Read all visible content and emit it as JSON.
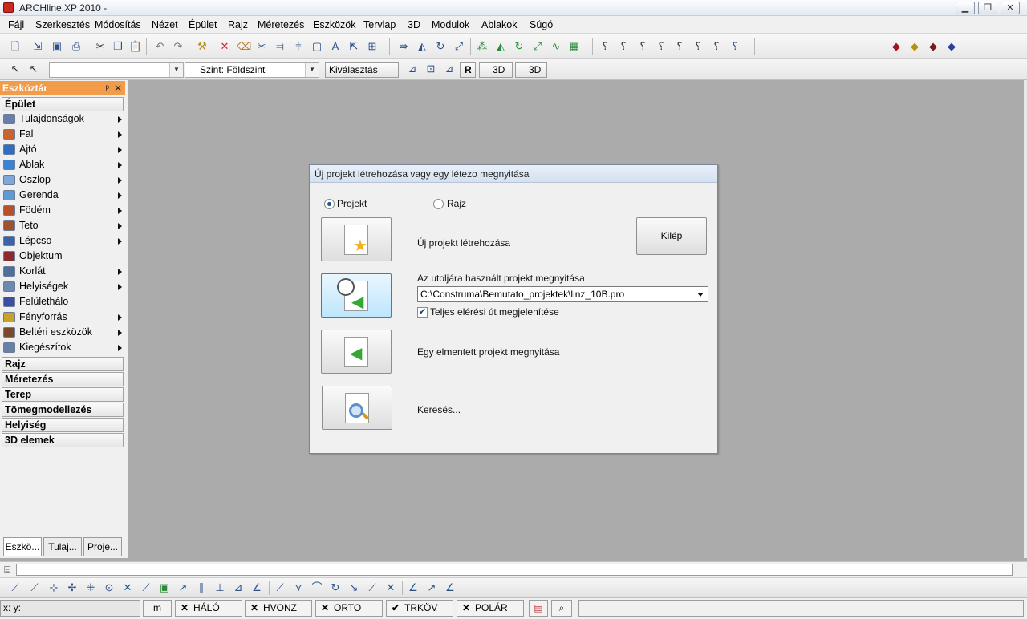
{
  "window": {
    "title": "ARCHline.XP 2010 -",
    "btn_min": "▁",
    "btn_restore": "❐",
    "btn_close": "✕"
  },
  "menu": [
    "Fájl",
    "Szerkesztés",
    "Módosítás",
    "Nézet",
    "Épület",
    "Rajz",
    "Méretezés",
    "Eszközök",
    "Tervlap",
    "3D",
    "Modulok",
    "Ablakok",
    "Súgó"
  ],
  "toolbar2": {
    "level_combo": "Szint:  Földszint",
    "select_button": "Kiválasztás",
    "btn_r": "R",
    "btn_3d_a": "3D",
    "btn_3d_b": "3D"
  },
  "panel": {
    "title": "Eszköztár",
    "pin": "ᵖ",
    "close": "✕",
    "section_epulet": "Épület",
    "items": [
      "Tulajdonságok",
      "Fal",
      "Ajtó",
      "Ablak",
      "Oszlop",
      "Gerenda",
      "Födém",
      "Teto",
      "Lépcso",
      "Objektum",
      "Korlát",
      "Helyiségek",
      "Felülethálo",
      "Fényforrás",
      "Beltéri eszközök",
      "Kiegészítok"
    ],
    "item_colors": [
      "#6a7fa6",
      "#c8642e",
      "#2d6fc2",
      "#3b82d0",
      "#7fa8d8",
      "#5e9ad6",
      "#b8502a",
      "#a0522d",
      "#3c62a8",
      "#8c2b2b",
      "#4d6f99",
      "#6f88ad",
      "#3a4fa0",
      "#c9a227",
      "#7a4a2a",
      "#6a7fa6"
    ],
    "item_arrows": [
      true,
      true,
      true,
      true,
      true,
      true,
      true,
      true,
      true,
      false,
      true,
      true,
      false,
      true,
      true,
      true
    ],
    "categories": [
      "Rajz",
      "Méretezés",
      "Terep",
      "Tömegmodellezés",
      "Helyiség",
      "3D elemek"
    ],
    "tabs": [
      "Eszkö...",
      "Tulaj...",
      "Proje..."
    ]
  },
  "dialog": {
    "title": "Új projekt létrehozása vagy egy létezo megnyitása",
    "radio_projekt": "Projekt",
    "radio_rajz": "Rajz",
    "new_project_label": "Új projekt létrehozása",
    "exit_button": "Kilép",
    "recent_label": "Az utoljára használt projekt megnyitása",
    "recent_path": "C:\\Construma\\Bemutato_projektek\\linz_10B.pro",
    "full_path_checkbox": "Teljes elérési út megjelenítése",
    "open_saved_label": "Egy elmentett projekt megnyitása",
    "search_label": "Keresés..."
  },
  "statusbar": {
    "coords": "x: y:",
    "unit": "m",
    "toggles": [
      {
        "mark": "✕",
        "label": "HÁLÓ"
      },
      {
        "mark": "✕",
        "label": "HVONZ"
      },
      {
        "mark": "✕",
        "label": "ORTO"
      },
      {
        "mark": "✔",
        "label": "TRKÖV"
      },
      {
        "mark": "✕",
        "label": "POLÁR"
      }
    ]
  },
  "colors": {
    "panel_title": "#f29c49",
    "canvas": "#ababab",
    "selected_button": "#bee6fd",
    "app_icon": "#c8281e"
  }
}
